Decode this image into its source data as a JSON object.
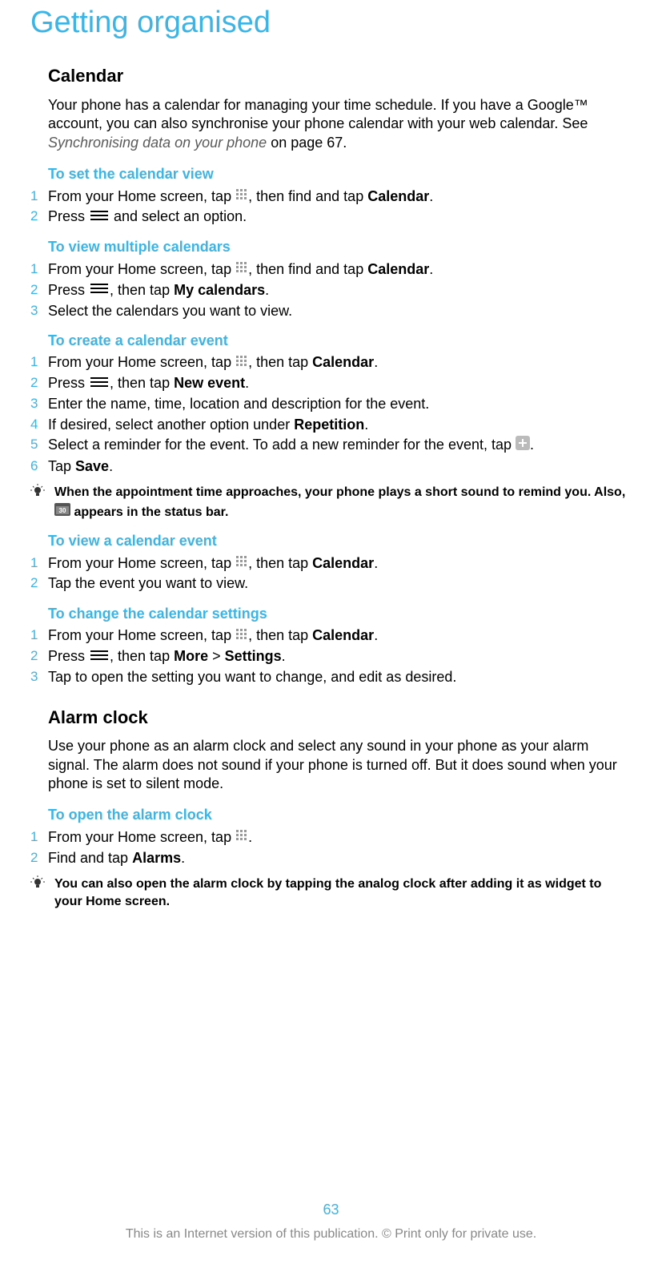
{
  "title": "Getting organised",
  "calendar": {
    "heading": "Calendar",
    "intro_1": "Your phone has a calendar for managing your time schedule. If you have a Google™ account, you can also synchronise your phone calendar with your web calendar. See ",
    "intro_link": "Synchronising data on your phone",
    "intro_2": " on page 67.",
    "sections": [
      {
        "title": "To set the calendar view",
        "steps": [
          {
            "n": "1",
            "pre": "From your Home screen, tap ",
            "icon": "grid",
            "post": ", then find and tap ",
            "bold": "Calendar",
            "end": "."
          },
          {
            "n": "2",
            "pre": "Press ",
            "icon": "menu",
            "post": " and select an option."
          }
        ]
      },
      {
        "title": "To view multiple calendars",
        "steps": [
          {
            "n": "1",
            "pre": "From your Home screen, tap ",
            "icon": "grid",
            "post": ", then find and tap ",
            "bold": "Calendar",
            "end": "."
          },
          {
            "n": "2",
            "pre": "Press ",
            "icon": "menu",
            "post": ", then tap ",
            "bold": "My calendars",
            "end": "."
          },
          {
            "n": "3",
            "pre": "Select the calendars you want to view."
          }
        ]
      },
      {
        "title": "To create a calendar event",
        "steps": [
          {
            "n": "1",
            "pre": "From your Home screen, tap ",
            "icon": "grid",
            "post": ", then tap ",
            "bold": "Calendar",
            "end": "."
          },
          {
            "n": "2",
            "pre": "Press ",
            "icon": "menu",
            "post": ", then tap ",
            "bold": "New event",
            "end": "."
          },
          {
            "n": "3",
            "pre": "Enter the name, time, location and description for the event."
          },
          {
            "n": "4",
            "pre": "If desired, select another option under ",
            "bold": "Repetition",
            "end": "."
          },
          {
            "n": "5",
            "pre": "Select a reminder for the event. To add a new reminder for the event, tap ",
            "icon": "plus",
            "end": "."
          },
          {
            "n": "6",
            "pre": "Tap ",
            "bold": "Save",
            "end": "."
          }
        ],
        "tip_pre": "When the appointment time approaches, your phone plays a short sound to remind you. Also, ",
        "tip_post": " appears in the status bar."
      },
      {
        "title": "To view a calendar event",
        "steps": [
          {
            "n": "1",
            "pre": "From your Home screen, tap ",
            "icon": "grid",
            "post": ", then tap ",
            "bold": "Calendar",
            "end": "."
          },
          {
            "n": "2",
            "pre": "Tap the event you want to view."
          }
        ]
      },
      {
        "title": "To change the calendar settings",
        "steps": [
          {
            "n": "1",
            "pre": "From your Home screen, tap ",
            "icon": "grid",
            "post": ", then tap ",
            "bold": "Calendar",
            "end": "."
          },
          {
            "n": "2",
            "pre": "Press ",
            "icon": "menu",
            "post": ", then tap ",
            "bold": "More",
            "mid": " > ",
            "bold2": "Settings",
            "end": "."
          },
          {
            "n": "3",
            "pre": "Tap to open the setting you want to change, and edit as desired."
          }
        ]
      }
    ]
  },
  "alarm": {
    "heading": "Alarm clock",
    "intro": "Use your phone as an alarm clock and select any sound in your phone as your alarm signal. The alarm does not sound if your phone is turned off. But it does sound when your phone is set to silent mode.",
    "section": {
      "title": "To open the alarm clock",
      "steps": [
        {
          "n": "1",
          "pre": "From your Home screen, tap ",
          "icon": "grid",
          "end": "."
        },
        {
          "n": "2",
          "pre": "Find and tap ",
          "bold": "Alarms",
          "end": "."
        }
      ],
      "tip": "You can also open the alarm clock by tapping the analog clock after adding it as widget to your Home screen."
    }
  },
  "page_number": "63",
  "footer": "This is an Internet version of this publication. © Print only for private use."
}
